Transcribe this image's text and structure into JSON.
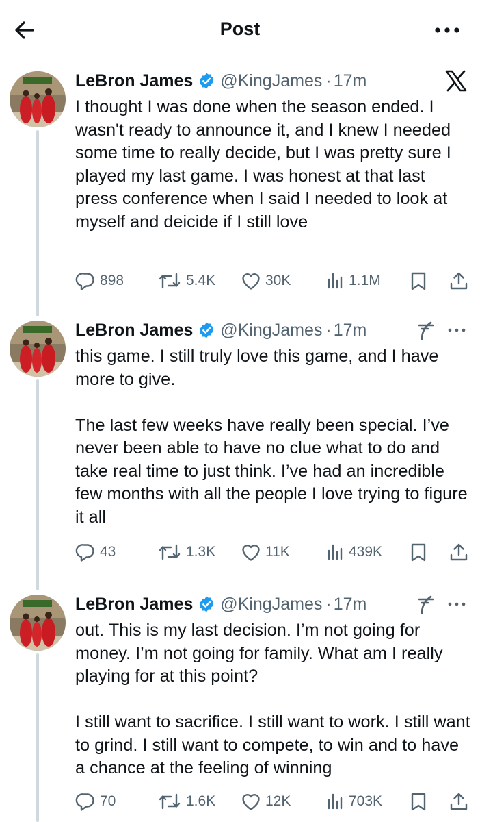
{
  "header": {
    "title": "Post"
  },
  "tweets": [
    {
      "name": "LeBron James",
      "handle": "@KingJames",
      "time": "17m",
      "text": "I thought I was done when the season ended. I wasn't ready to announce it, and I knew I needed some time to really decide, but I was pretty sure I played my last game. I was honest at that last press conference when I said I needed to look at myself and deicide if I still love",
      "replies": "898",
      "reposts": "5.4K",
      "likes": "30K",
      "views": "1.1M"
    },
    {
      "name": "LeBron James",
      "handle": "@KingJames",
      "time": "17m",
      "text": "this game. I still truly love this game, and I have more to give.\n\nThe last few weeks have really been special. I’ve never been able to have no clue what to do and take real time to just think. I’ve had an incredible few months with all the people I love trying to figure it all",
      "replies": "43",
      "reposts": "1.3K",
      "likes": "11K",
      "views": "439K"
    },
    {
      "name": "LeBron James",
      "handle": "@KingJames",
      "time": "17m",
      "text": "out. This is my last decision. I’m not going for money. I’m not going for family. What am I really playing for at this point?\n\nI still want to sacrifice. I still want to work. I still want to grind. I still want to compete, to win and to have a chance at the feeling of winning",
      "replies": "70",
      "reposts": "1.6K",
      "likes": "12K",
      "views": "703K"
    }
  ],
  "colors": {
    "verified": "#1d9bf0",
    "muted": "#536471",
    "text": "#0f1419",
    "thread": "#cfd9de"
  },
  "icons": [
    "back-arrow-icon",
    "more-icon",
    "x-logo-icon",
    "translate-icon",
    "verified-badge-icon",
    "reply-icon",
    "repost-icon",
    "like-icon",
    "views-icon",
    "bookmark-icon",
    "share-icon"
  ]
}
